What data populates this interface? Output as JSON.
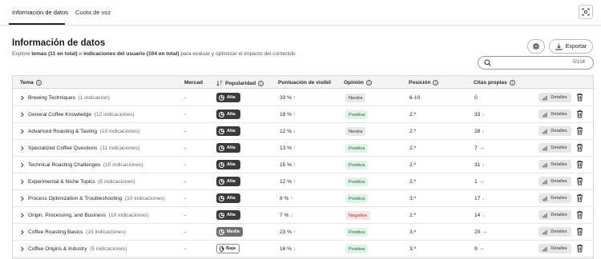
{
  "tabs": [
    {
      "label": "Información de datos",
      "active": true
    },
    {
      "label": "Cuota de voz",
      "active": false
    }
  ],
  "header": {
    "title": "Información de datos",
    "subtitle_pre": "Explore ",
    "subtitle_bold1": "temas (11 en total)",
    "subtitle_mid": " e ",
    "subtitle_bold2": "indicaciones del usuario (104 en total)",
    "subtitle_post": " para evaluar y optimizar el impacto del contenido",
    "export_label": "Exportar"
  },
  "search": {
    "placeholder": "",
    "count": "0/104"
  },
  "columns": {
    "topic": "Tema",
    "market": "Mercad",
    "popularity": "Popularidad",
    "visibility": "Puntuación de visibil",
    "sentiment": "Opinión",
    "position": "Posición",
    "citations": "Citas propias"
  },
  "rows": [
    {
      "topic": "Brewing Techniques",
      "count": "(1 indicación)",
      "market": "-",
      "popularity": "Alta",
      "pop_level": "alta",
      "visibility": "33 %",
      "vis_trend": "up",
      "sentiment": "Neutra",
      "sent_level": "neutra",
      "position": "6-10",
      "citations": "0",
      "cit_trend": "",
      "details": "Detalles"
    },
    {
      "topic": "General Coffee Knowledge",
      "count": "(12 indicaciones)",
      "market": "-",
      "popularity": "Alta",
      "pop_level": "alta",
      "visibility": "18 %",
      "vis_trend": "up",
      "sentiment": "Positiva",
      "sent_level": "positiva",
      "position": "2.º",
      "citations": "33",
      "cit_trend": "down",
      "details": "Detalles"
    },
    {
      "topic": "Advanced Roasting & Tasting",
      "count": "(10 indicaciones)",
      "market": "-",
      "popularity": "Alta",
      "pop_level": "alta",
      "visibility": "12 %",
      "vis_trend": "down",
      "sentiment": "Neutra",
      "sent_level": "neutra",
      "position": "2.º",
      "citations": "28",
      "cit_trend": "down",
      "details": "Detalles"
    },
    {
      "topic": "Specialized Coffee Questions",
      "count": "(11 indicaciones)",
      "market": "-",
      "popularity": "Alta",
      "pop_level": "alta",
      "visibility": "13 %",
      "vis_trend": "up",
      "sentiment": "Positiva",
      "sent_level": "positiva",
      "position": "2.º",
      "citations": "7",
      "cit_trend": "flat",
      "details": "Detalles"
    },
    {
      "topic": "Technical Roasting Challenges",
      "count": "(15 indicaciones)",
      "market": "-",
      "popularity": "Alta",
      "pop_level": "alta",
      "visibility": "15 %",
      "vis_trend": "up",
      "sentiment": "Positiva",
      "sent_level": "positiva",
      "position": "2.º",
      "citations": "31",
      "cit_trend": "down",
      "details": "Detalles"
    },
    {
      "topic": "Experimental & Niche Topics",
      "count": "(5 indicaciones)",
      "market": "-",
      "popularity": "Alta",
      "pop_level": "alta",
      "visibility": "12 %",
      "vis_trend": "up",
      "sentiment": "Positiva",
      "sent_level": "positiva",
      "position": "2.º",
      "citations": "1",
      "cit_trend": "flat",
      "details": "Detalles"
    },
    {
      "topic": "Process Optimization & Troubleshooting",
      "count": "(10 indicaciones)",
      "market": "-",
      "popularity": "Alta",
      "pop_level": "alta",
      "visibility": "8 %",
      "vis_trend": "up",
      "sentiment": "Positiva",
      "sent_level": "positiva",
      "position": "3.º",
      "citations": "17",
      "cit_trend": "down",
      "details": "Detalles"
    },
    {
      "topic": "Origin, Processing, and Business",
      "count": "(10 indicaciones)",
      "market": "-",
      "popularity": "Alta",
      "pop_level": "alta",
      "visibility": "7 %",
      "vis_trend": "down",
      "sentiment": "Negativa",
      "sent_level": "negativa",
      "position": "2.º",
      "citations": "14",
      "cit_trend": "down",
      "details": "Detalles"
    },
    {
      "topic": "Coffee Roasting Basics",
      "count": "(15 indicaciones)",
      "market": "-",
      "popularity": "Media",
      "pop_level": "media",
      "visibility": "23 %",
      "vis_trend": "up",
      "sentiment": "Positiva",
      "sent_level": "positiva",
      "position": "3.º",
      "citations": "20",
      "cit_trend": "flat",
      "details": "Detalles"
    },
    {
      "topic": "Coffee Origins & Industry",
      "count": "(5 indicaciones)",
      "market": "-",
      "popularity": "Baja",
      "pop_level": "baja",
      "visibility": "16 %",
      "vis_trend": "down",
      "sentiment": "Positiva",
      "sent_level": "positiva",
      "position": "3.º",
      "citations": "9",
      "cit_trend": "flat",
      "details": "Detalles"
    }
  ],
  "icons": {
    "focus": "focus-icon",
    "settings": "gear-icon",
    "export": "download-icon",
    "search": "search-icon",
    "chevron": "chevron-right-icon",
    "sort": "sort-icon",
    "info": "info-icon",
    "clock": "clock-icon",
    "bars": "bar-chart-icon",
    "trash": "trash-icon"
  },
  "colors": {
    "up": "#2f9a58",
    "down": "#d9534f",
    "positiva_bg": "#dff3e6",
    "negativa_bg": "#fbe5e3",
    "neutra_bg": "#e8e8e8"
  }
}
